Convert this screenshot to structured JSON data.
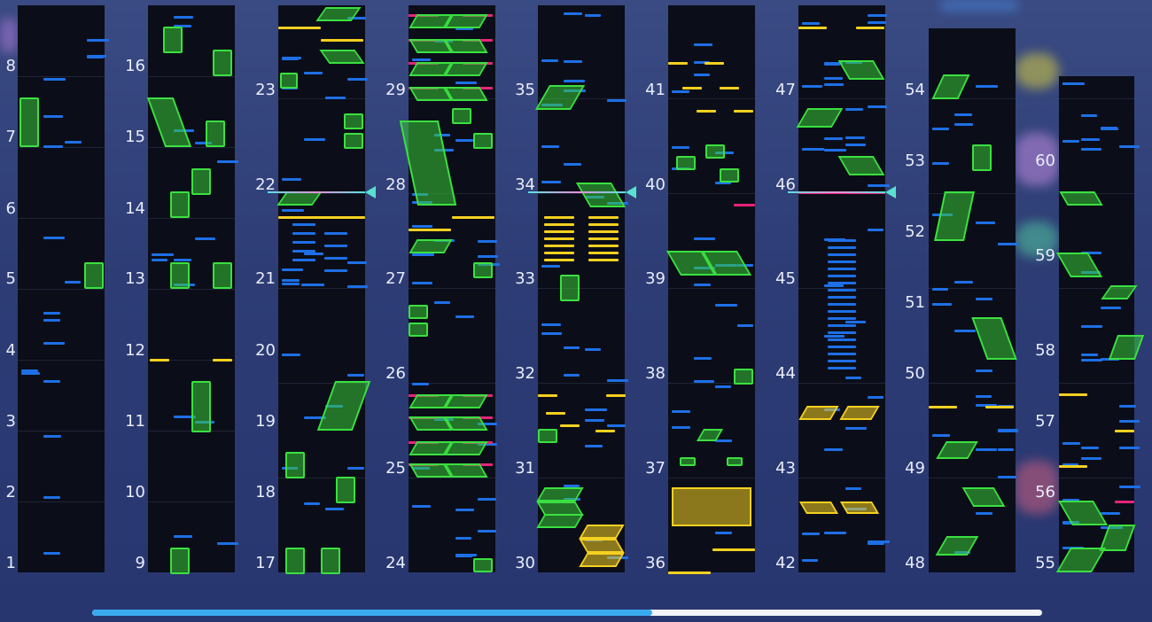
{
  "scroll": {
    "progress": 0.59
  },
  "columns": [
    {
      "labels": [
        "8",
        "7",
        "6",
        "5",
        "4",
        "3",
        "2",
        "1"
      ]
    },
    {
      "labels": [
        "16",
        "15",
        "14",
        "13",
        "12",
        "11",
        "10",
        "9"
      ]
    },
    {
      "labels": [
        "23",
        "22",
        "21",
        "20",
        "19",
        "18",
        "17"
      ]
    },
    {
      "labels": [
        "29",
        "28",
        "27",
        "26",
        "25",
        "24"
      ]
    },
    {
      "labels": [
        "35",
        "34",
        "33",
        "32",
        "31",
        "30"
      ]
    },
    {
      "labels": [
        "41",
        "40",
        "39",
        "38",
        "37",
        "36"
      ]
    },
    {
      "labels": [
        "47",
        "46",
        "45",
        "44",
        "43",
        "42"
      ]
    },
    {
      "labels": [
        "54",
        "53",
        "52",
        "51",
        "50",
        "49",
        "48"
      ]
    },
    {
      "labels": [
        "60",
        "59",
        "58",
        "57",
        "56",
        "55"
      ]
    }
  ],
  "colors": {
    "tap": "#1e6fe6",
    "flick": "#f5d020",
    "ex": "#e6247a",
    "hold": "#3be040",
    "cursor": "#5ae0d0"
  }
}
